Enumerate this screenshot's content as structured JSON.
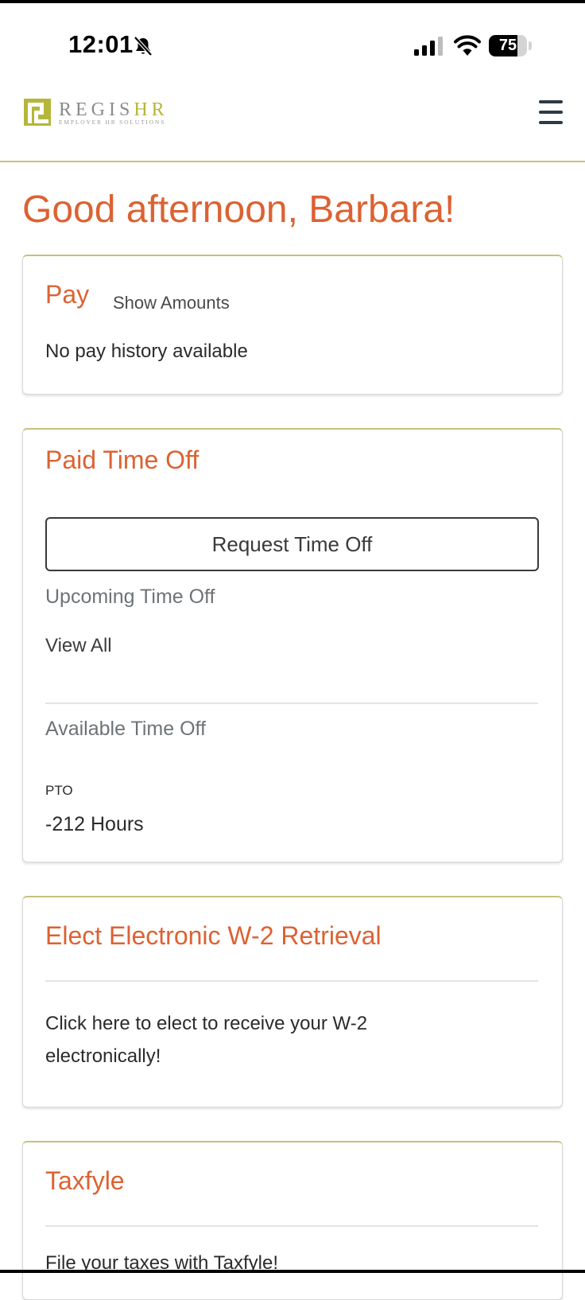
{
  "status_bar": {
    "time": "12:01",
    "battery_level": "75"
  },
  "header": {
    "logo_text": "REGIS",
    "logo_accent": "HR",
    "logo_tagline": "EMPLOYER HR SOLUTIONS",
    "menu_icon": "hamburger-menu-icon"
  },
  "greeting": "Good afternoon, Barbara!",
  "pay_card": {
    "title": "Pay",
    "show_amounts_label": "Show Amounts",
    "empty_message": "No pay history available"
  },
  "pto_card": {
    "title": "Paid Time Off",
    "request_button_label": "Request Time Off",
    "upcoming_heading": "Upcoming Time Off",
    "view_all_label": "View All",
    "available_heading": "Available Time Off",
    "balance_type": "PTO",
    "balance_value": "-212 Hours"
  },
  "w2_card": {
    "title": "Elect Electronic W-2 Retrieval",
    "body": "Click here to elect to receive your W-2 electronically!"
  },
  "taxfyle_card": {
    "title": "Taxfyle",
    "body": "File your taxes with Taxfyle!"
  },
  "colors": {
    "accent_orange": "#dc6232",
    "brand_olive": "#c6c27a",
    "logo_green": "#b5b63a"
  }
}
